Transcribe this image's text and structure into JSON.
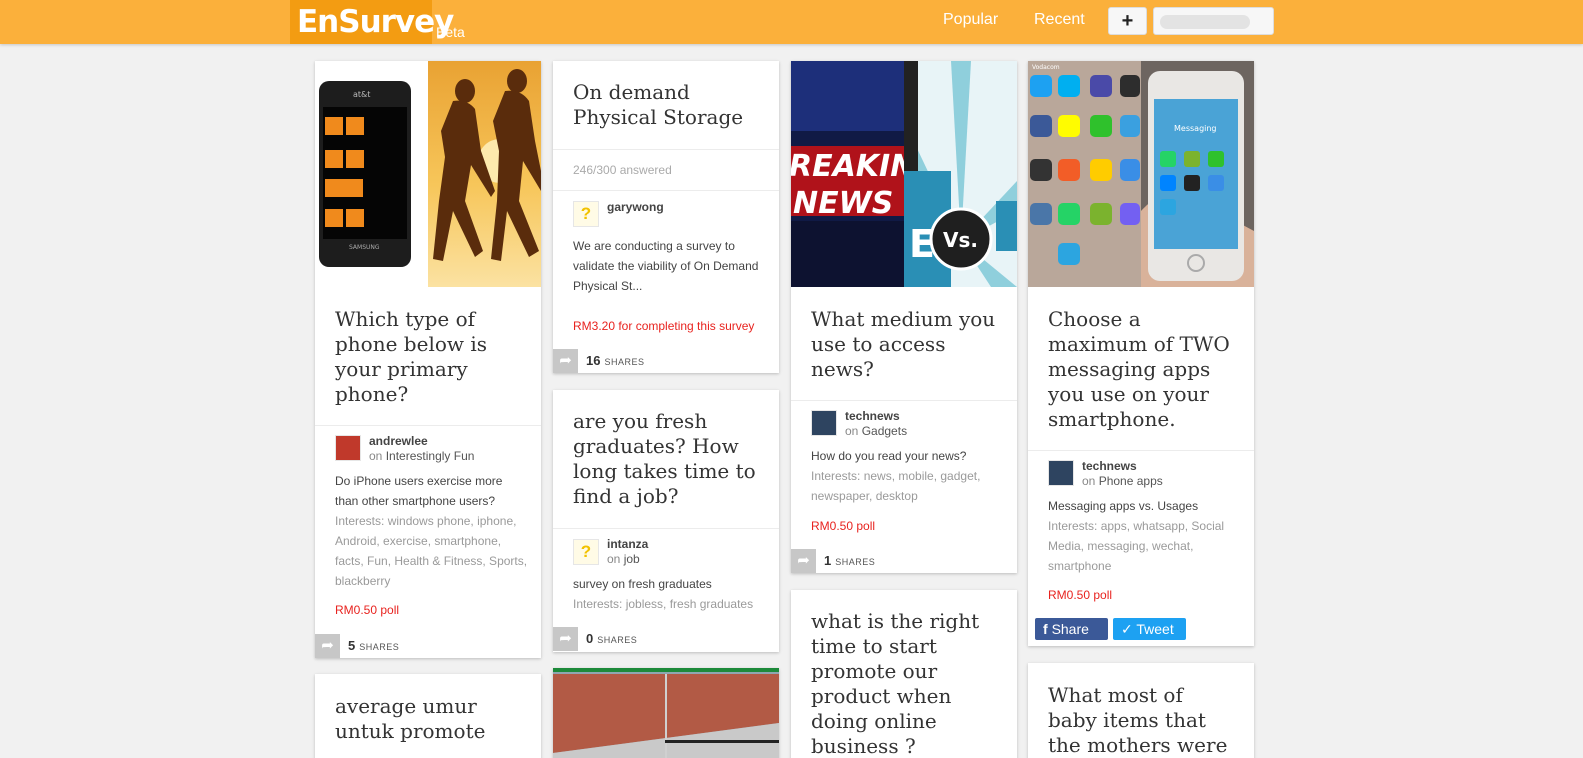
{
  "header": {
    "logo": "EnSurvey",
    "beta": "Beta",
    "nav": {
      "popular": "Popular",
      "recent": "Recent"
    },
    "add_label": "+"
  },
  "colors": {
    "brand": "#fbb03b",
    "logo_bg": "#f39c12",
    "reward": "#e8231f",
    "facebook": "#3b5998",
    "twitter": "#1da1f2"
  },
  "share_label": "SHARES",
  "cards": {
    "c1": {
      "title": "Which type of phone below is your primary phone?",
      "author": "andrewlee",
      "on": "on",
      "category": "Interestingly Fun",
      "desc": "Do iPhone users exercise more than other smartphone users?",
      "interests": "Interests: windows phone, iphone, Android, exercise, smartphone, facts, Fun, Health & Fitness, Sports, blackberry",
      "reward": "RM0.50 poll",
      "shares": "5",
      "phone_brand": "at&t",
      "phone_maker": "SAMSUNG"
    },
    "c2": {
      "title": "On demand Physical Storage",
      "answered": "246/300 answered",
      "author": "garywong",
      "desc": "We are conducting a survey to validate the viability of On Demand Physical St...",
      "reward": "RM3.20 for completing this survey",
      "shares": "16"
    },
    "c3": {
      "title": "are you fresh graduates? How long takes time to find a job?",
      "author": "intanza",
      "on": "on",
      "category": "job",
      "desc": "survey on fresh graduates",
      "interests": "Interests: jobless, fresh graduates",
      "shares": "0"
    },
    "c4": {
      "title": "What medium you use to access news?",
      "author": "technews",
      "on": "on",
      "category": "Gadgets",
      "desc": "How do you read your news?",
      "interests": "Interests: news, mobile, gadget, newspaper, desktop",
      "reward": "RM0.50 poll",
      "shares": "1",
      "img_text_1": "REAKIN",
      "img_text_2": "NEWS",
      "img_vs": "Vs."
    },
    "c5": {
      "title": "what is the right time to start promote our product when doing online business ?"
    },
    "c6": {
      "title": "Choose a maximum of TWO messaging apps you use on your smartphone.",
      "author": "technews",
      "on": "on",
      "category": "Phone apps",
      "desc": "Messaging apps vs. Usages",
      "interests": "Interests: apps, whatsapp, Social Media, messaging, wechat, smartphone",
      "reward": "RM0.50 poll",
      "fb": "Share",
      "tw": "Tweet",
      "img_messaging": "Messaging",
      "img_carrier": "Vodacom"
    },
    "c7": {
      "title": "average umur untuk promote"
    },
    "c8": {
      "title": "What most of baby items that the mothers were"
    }
  }
}
